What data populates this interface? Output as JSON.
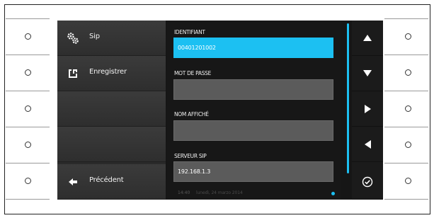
{
  "menu": {
    "items": [
      {
        "label": "Sip",
        "icon": "gears-icon"
      },
      {
        "label": "Enregistrer",
        "icon": "save-icon"
      },
      {
        "label": ""
      },
      {
        "label": ""
      },
      {
        "label": "Précédent",
        "icon": "back-arrow-icon"
      }
    ]
  },
  "form": {
    "fields": [
      {
        "label": "IDENTIFIANT",
        "value": "00401201002",
        "active": true
      },
      {
        "label": "MOT DE PASSE",
        "value": ""
      },
      {
        "label": "NOM AFFICHÉ",
        "value": ""
      },
      {
        "label": "SERVEUR SIP",
        "value": "192.168.1.3"
      }
    ]
  },
  "status": {
    "time": "14:40",
    "date": "lunedì, 24 marzo 2014"
  },
  "nav": {
    "buttons": [
      "arrow-up-icon",
      "arrow-down-icon",
      "arrow-right-icon",
      "arrow-left-icon",
      "check-circle-icon"
    ]
  },
  "colors": {
    "accent": "#1cc0f2",
    "menu_bg": "#3b3b3b",
    "screen_bg": "#161616",
    "field_bg": "#5b5b5b"
  }
}
